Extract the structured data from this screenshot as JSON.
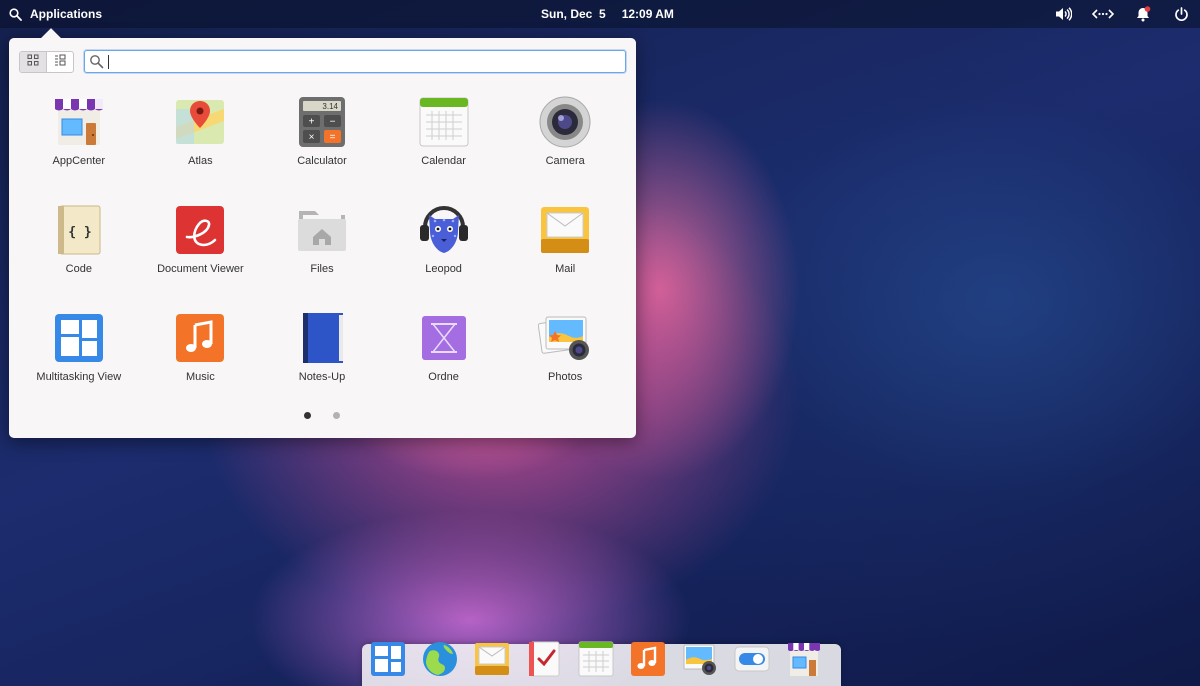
{
  "panel": {
    "applications_label": "Applications",
    "date": "Sun, Dec  5",
    "time": "12:09 AM",
    "indicators": [
      "volume-icon",
      "network-icon",
      "notifications-icon",
      "power-icon"
    ]
  },
  "launcher": {
    "search": {
      "value": "",
      "placeholder": ""
    },
    "view_modes": [
      "grid-view-icon",
      "category-view-icon"
    ],
    "active_view": "grid",
    "apps": [
      {
        "name": "AppCenter"
      },
      {
        "name": "Atlas"
      },
      {
        "name": "Calculator",
        "display": "3.14"
      },
      {
        "name": "Calendar"
      },
      {
        "name": "Camera"
      },
      {
        "name": "Code",
        "glyph": "{ }"
      },
      {
        "name": "Document Viewer"
      },
      {
        "name": "Files"
      },
      {
        "name": "Leopod"
      },
      {
        "name": "Mail"
      },
      {
        "name": "Multitasking View"
      },
      {
        "name": "Music"
      },
      {
        "name": "Notes-Up"
      },
      {
        "name": "Ordne"
      },
      {
        "name": "Photos"
      }
    ],
    "pages": 2,
    "current_page": 1
  },
  "dock": {
    "items": [
      "multitasking-view-icon",
      "web-browser-icon",
      "mail-icon",
      "tasks-icon",
      "calendar-icon",
      "music-icon",
      "photos-icon",
      "settings-icon",
      "appcenter-icon"
    ]
  },
  "colors": {
    "accent": "#3689e6",
    "launcher_bg": "#f8f6f7",
    "panel_text": "#ffffff"
  }
}
